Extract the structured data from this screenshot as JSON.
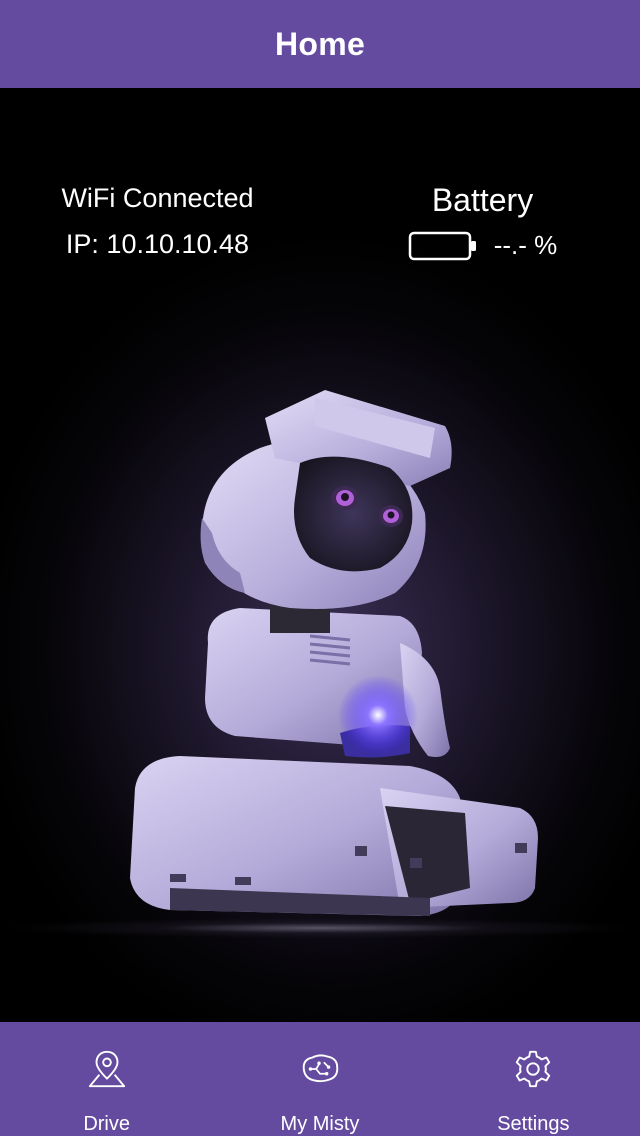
{
  "header": {
    "title": "Home"
  },
  "status": {
    "wifi_label": "WiFi Connected",
    "ip_label": "IP: 10.10.10.48",
    "battery_title": "Battery",
    "battery_value": "--.- %",
    "battery_icon": "battery-empty-icon"
  },
  "tabs": [
    {
      "label": "Drive",
      "icon": "map-pin-icon"
    },
    {
      "label": "My Misty",
      "icon": "brain-icon"
    },
    {
      "label": "Settings",
      "icon": "gear-icon"
    }
  ],
  "colors": {
    "brand": "#654ba0",
    "background": "#000000",
    "text": "#ffffff",
    "robot_body": "#b9b0dc",
    "robot_accent_light": "#5a3cff"
  }
}
